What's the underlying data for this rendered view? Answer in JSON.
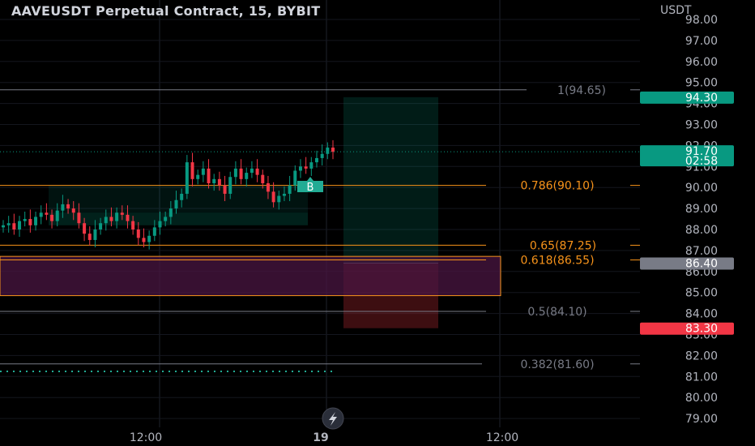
{
  "header": {
    "title": "AAVEUSDT Perpetual Contract, 15, BYBIT"
  },
  "price_axis": {
    "unit": "USDT",
    "ticks": [
      "98.00",
      "97.00",
      "96.00",
      "95.00",
      "94.00",
      "93.00",
      "92.00",
      "91.00",
      "90.00",
      "89.00",
      "88.00",
      "87.00",
      "86.00",
      "85.00",
      "84.00",
      "83.00",
      "82.00",
      "81.00",
      "80.00",
      "79.00"
    ]
  },
  "time_axis": {
    "ticks": [
      "12:00",
      "19",
      "12:00"
    ]
  },
  "fib_levels": [
    {
      "label": "1(94.65)",
      "value": 94.65,
      "color": "#787b86"
    },
    {
      "label": "0.786(90.10)",
      "value": 90.1,
      "color": "#f7931a"
    },
    {
      "label": "0.65(87.25)",
      "value": 87.25,
      "color": "#f7931a"
    },
    {
      "label": "0.618(86.55)",
      "value": 86.55,
      "color": "#f7931a"
    },
    {
      "label": "0.5(84.10)",
      "value": 84.1,
      "color": "#787b86"
    },
    {
      "label": "0.382(81.60)",
      "value": 81.6,
      "color": "#787b86"
    }
  ],
  "price_tags": [
    {
      "id": "target",
      "value": 94.3,
      "label": "94.30",
      "color": "#089981"
    },
    {
      "id": "current",
      "value": 91.7,
      "label": "91.70",
      "sub": "02:58",
      "color": "#089981"
    },
    {
      "id": "entry",
      "value": 86.4,
      "label": "86.40",
      "color": "#787b86"
    },
    {
      "id": "stop",
      "value": 83.3,
      "label": "83.30",
      "color": "#f23645"
    }
  ],
  "marker": {
    "label": "B",
    "color": "#22ab94"
  },
  "colors": {
    "up": "#089981",
    "down": "#f23645",
    "fib_orange": "#f7931a",
    "zone_purple": "#4a1642"
  },
  "chart_data": {
    "type": "candlestick",
    "title": "AAVEUSDT Perpetual Contract, 15, BYBIT",
    "ylabel": "USDT",
    "ylim": [
      78.8,
      98.4
    ],
    "xticks": [
      "12:00",
      "19",
      "12:00"
    ],
    "close_series": [
      88.2,
      88.3,
      88.0,
      88.4,
      88.5,
      88.2,
      88.6,
      88.8,
      88.7,
      88.4,
      88.9,
      89.2,
      89.0,
      88.8,
      88.3,
      87.8,
      87.5,
      88.0,
      88.3,
      88.6,
      88.4,
      88.8,
      88.7,
      88.4,
      88.0,
      87.6,
      87.4,
      87.7,
      88.1,
      88.4,
      88.6,
      89.0,
      89.4,
      89.7,
      91.2,
      90.4,
      90.6,
      90.9,
      90.2,
      90.4,
      90.1,
      89.7,
      90.5,
      90.9,
      90.4,
      90.7,
      90.9,
      90.6,
      90.2,
      89.8,
      89.3,
      89.6,
      89.7,
      90.1,
      90.8,
      91.0,
      90.9,
      91.2,
      91.4,
      91.6,
      91.9,
      91.7
    ],
    "last_price": 91.7,
    "countdown": "02:58"
  }
}
